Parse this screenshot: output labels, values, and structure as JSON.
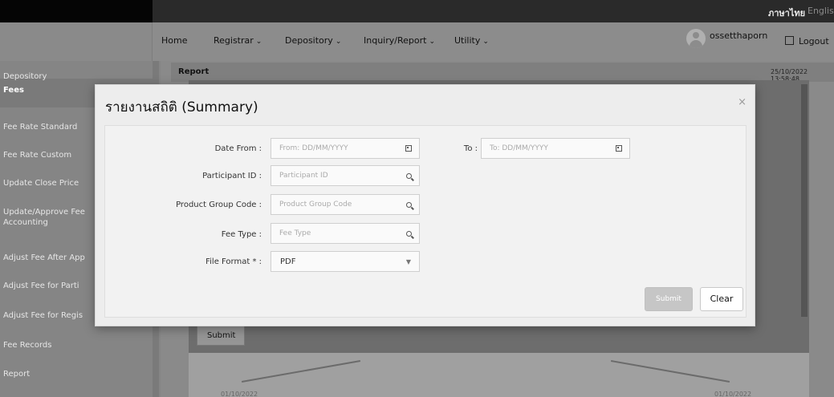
{
  "header": {
    "lang_th": "ภาษาไทย",
    "lang_en": "English",
    "user": "ossetthaporn",
    "logout": "Logout"
  },
  "nav": {
    "items": [
      {
        "label": "Home",
        "dropdown": false
      },
      {
        "label": "Registrar",
        "dropdown": true
      },
      {
        "label": "Depository",
        "dropdown": true
      },
      {
        "label": "Inquiry/Report",
        "dropdown": true
      },
      {
        "label": "Utility",
        "dropdown": true
      }
    ]
  },
  "sidebar": {
    "section": "Depository",
    "title": "Fees",
    "items": [
      "Fee Rate Standard",
      "Fee Rate Custom",
      "Update Close Price",
      "Update/Approve Fee Accounting",
      "Adjust Fee After App",
      "Adjust Fee for Parti",
      "Adjust Fee for Regis",
      "Fee Records",
      "Report"
    ]
  },
  "main": {
    "report_title": "Report",
    "timestamp": "25/10/2022 13:58:48",
    "submit": "Submit",
    "date_left": "01/10/2022",
    "date_right": "01/10/2022"
  },
  "modal": {
    "title": "รายงานสถิติ (Summary)",
    "close": "×",
    "date_from_label": "Date From :",
    "date_from_placeholder": "From: DD/MM/YYYY",
    "to_label": "To :",
    "to_placeholder": "To: DD/MM/YYYY",
    "participant_label": "Participant ID :",
    "participant_placeholder": "Participant ID",
    "product_label": "Product Group Code :",
    "product_placeholder": "Product Group Code",
    "fee_type_label": "Fee Type :",
    "fee_type_placeholder": "Fee Type",
    "file_format_label": "File Format * :",
    "file_format_value": "PDF",
    "submit": "Submit",
    "clear": "Clear"
  }
}
